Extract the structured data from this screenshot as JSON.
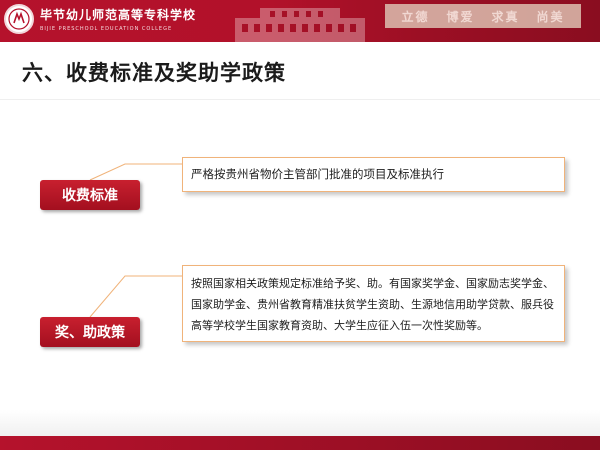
{
  "header": {
    "school_name": "毕节幼儿师范高等专科学校",
    "school_name_en": "BIJIE PRESCHOOL EDUCATION COLLEGE",
    "logo_icon": "school-seal-icon",
    "slogan": [
      "立德",
      "博爱",
      "求真",
      "尚美"
    ],
    "brand_color": "#b5122c"
  },
  "slide": {
    "title": "六、收费标准及奖助学政策",
    "sections": [
      {
        "label": "收费标准",
        "text": "严格按贵州省物价主管部门批准的项目及标准执行"
      },
      {
        "label": "奖、助政策",
        "text": "按照国家相关政策规定标准给予奖、助。有国家奖学金、国家励志奖学金、国家助学金、贵州省教育精准扶贫学生资助、生源地信用助学贷款、服兵役高等学校学生国家教育资助、大学生应征入伍一次性奖励等。"
      }
    ],
    "accent_color": "#f0b37a"
  }
}
